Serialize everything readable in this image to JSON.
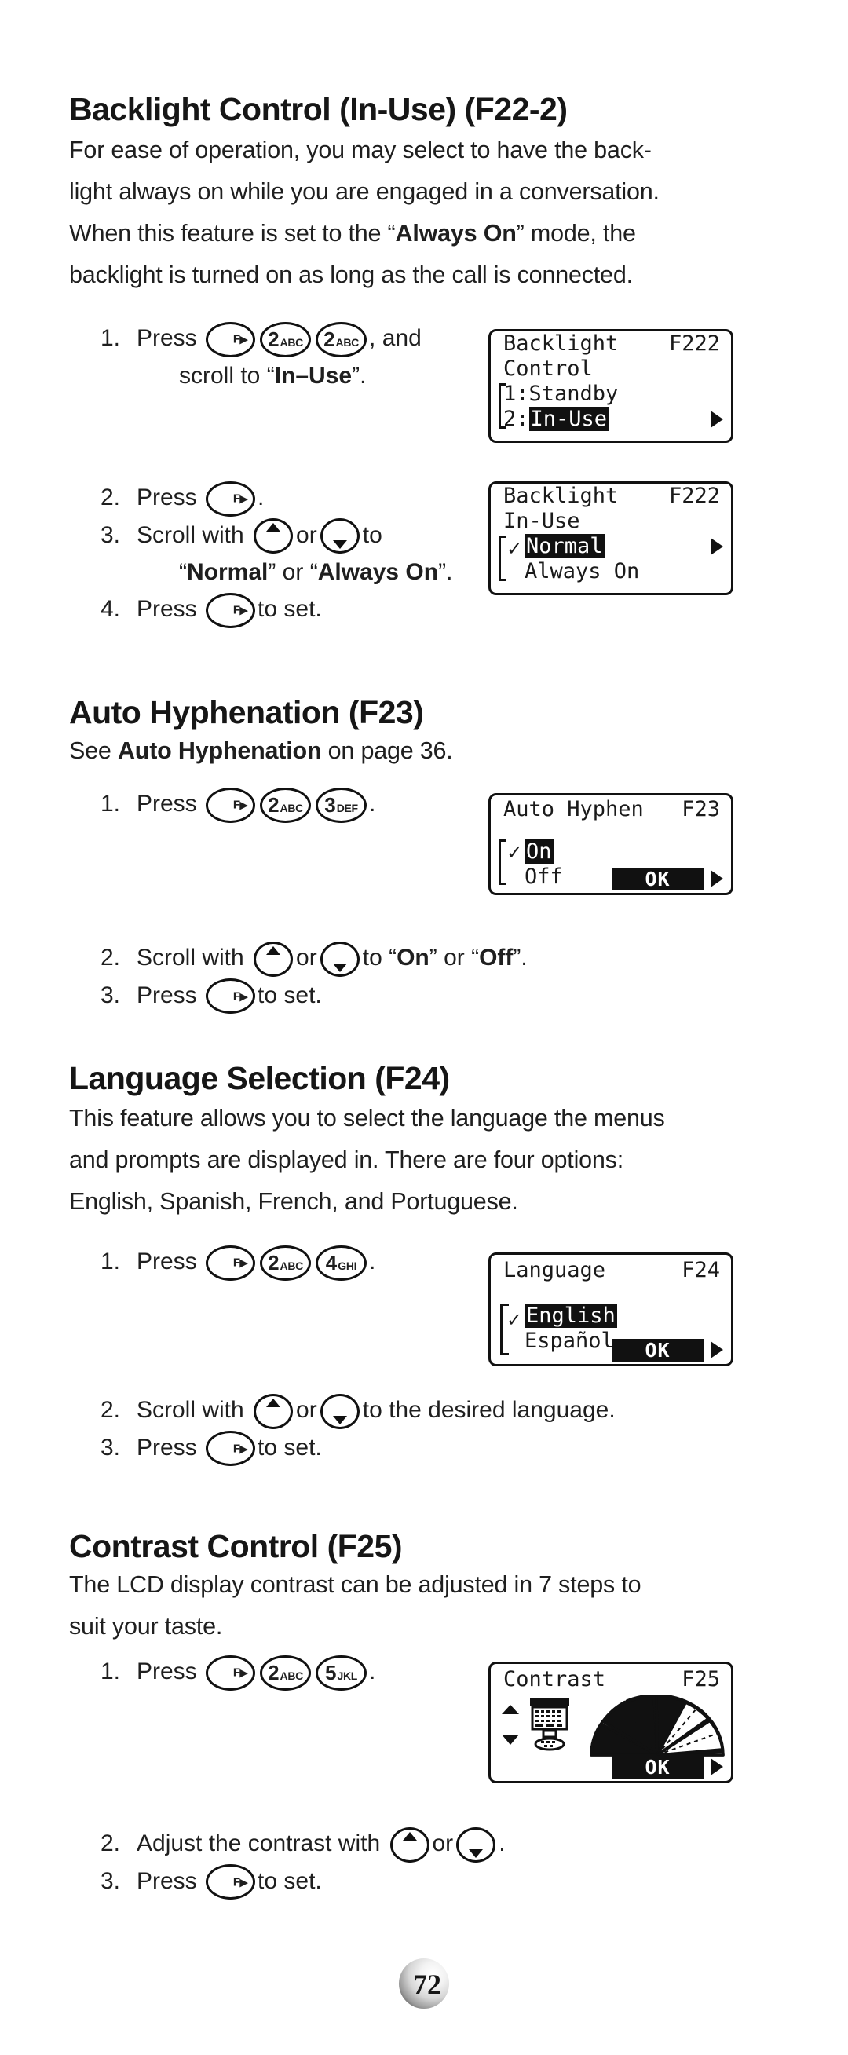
{
  "page": {
    "number": "72"
  },
  "sections": [
    {
      "id": "backlight",
      "title": "Backlight Control (In-Use) (F22-2)",
      "body_lines": [
        "For ease of operation, you may select to have the back-",
        "light always on while you are engaged in a conversation.",
        "When this feature is set to the “Always On” mode, the",
        "backlight is turned on as long as the call is connected."
      ],
      "body_bold": "Always On",
      "steps": [
        {
          "num": "1.",
          "press": "Press",
          "keys": [
            "F",
            "2 ABC",
            "2 ABC"
          ],
          "tail": ", and",
          "cont": "scroll to “In–Use”.",
          "cont_bold": "In–Use"
        },
        {
          "num": "2.",
          "press": "Press",
          "keys": [
            "F"
          ],
          "tail": "."
        },
        {
          "num": "3.",
          "press": "Scroll with",
          "keys": [
            "up",
            "down"
          ],
          "mid": "or",
          "tail": "to",
          "cont": "“Normal” or “Always On”."
        },
        {
          "num": "4.",
          "press": "Press",
          "keys": [
            "F"
          ],
          "tail": "to set."
        }
      ],
      "lcds": [
        {
          "title": "Backlight",
          "code": "F222",
          "lines": [
            "Control",
            "1:Standby",
            "2:In-Use"
          ],
          "highlight": "In-Use",
          "arrow": true,
          "ok": false,
          "check": false,
          "bracket": true
        },
        {
          "title": "Backlight",
          "code": "F222",
          "lines": [
            "In-Use",
            "Normal",
            "Always On"
          ],
          "highlight": "Normal",
          "arrow": true,
          "ok": false,
          "check": true,
          "bracket": true
        }
      ]
    },
    {
      "id": "hyphen",
      "title": "Auto Hyphenation (F23)",
      "body_lines": [
        "See Auto Hyphenation on page 36."
      ],
      "body_bold": "Auto Hyphenation",
      "steps": [
        {
          "num": "1.",
          "press": "Press",
          "keys": [
            "F",
            "2 ABC",
            "3 DEF"
          ],
          "tail": "."
        },
        {
          "num": "2.",
          "press": "Scroll with",
          "keys": [
            "up",
            "down"
          ],
          "mid": "or",
          "tail": "to “On” or “Off”."
        },
        {
          "num": "3.",
          "press": "Press",
          "keys": [
            "F"
          ],
          "tail": "to set."
        }
      ],
      "lcds": [
        {
          "title": "Auto Hyphen",
          "code": "F23",
          "lines": [
            "On",
            "Off"
          ],
          "highlight": "On",
          "arrow": true,
          "ok": true,
          "ok_label": "OK",
          "check": true,
          "bracket": true
        }
      ]
    },
    {
      "id": "language",
      "title": "Language Selection (F24)",
      "body_lines": [
        "This feature allows you to select the language the menus",
        "and prompts are displayed in. There are four options:",
        "English, Spanish, French, and Portuguese."
      ],
      "steps": [
        {
          "num": "1.",
          "press": "Press",
          "keys": [
            "F",
            "2 ABC",
            "4 GHI"
          ],
          "tail": "."
        },
        {
          "num": "2.",
          "press": "Scroll with",
          "keys": [
            "up",
            "down"
          ],
          "mid": "or",
          "tail": "to the desired language."
        },
        {
          "num": "3.",
          "press": "Press",
          "keys": [
            "F"
          ],
          "tail": "to set."
        }
      ],
      "lcds": [
        {
          "title": "Language",
          "code": "F24",
          "lines": [
            "English",
            "Español"
          ],
          "highlight": "English",
          "arrow": true,
          "ok": true,
          "ok_label": "OK",
          "check": true,
          "bracket": true
        }
      ]
    },
    {
      "id": "contrast",
      "title": "Contrast Control (F25)",
      "body_lines": [
        "The LCD display contrast can be adjusted in 7 steps to",
        "suit your taste."
      ],
      "steps": [
        {
          "num": "1.",
          "press": "Press",
          "keys": [
            "F",
            "2 ABC",
            "5 JKL"
          ],
          "tail": "."
        },
        {
          "num": "2.",
          "press": "Adjust the contrast with",
          "keys": [
            "up",
            "down"
          ],
          "mid": "or",
          "tail": "."
        },
        {
          "num": "3.",
          "press": "Press",
          "keys": [
            "F"
          ],
          "tail": "to set."
        }
      ],
      "lcds": [
        {
          "title": "Contrast",
          "code": "F25",
          "lines": [],
          "graphic": "contrast-fan",
          "fan_segments": 7,
          "fan_filled": 4,
          "arrow": true,
          "ok": true,
          "ok_label": "OK",
          "check": false,
          "bracket": false
        }
      ]
    }
  ],
  "keys": {
    "f_label": "F",
    "f_arrow": "▶",
    "k2": {
      "digit": "2",
      "letters": "ABC"
    },
    "k3": {
      "digit": "3",
      "letters": "DEF"
    },
    "k4": {
      "digit": "4",
      "letters": "GHI"
    },
    "k5": {
      "digit": "5",
      "letters": "JKL"
    }
  }
}
